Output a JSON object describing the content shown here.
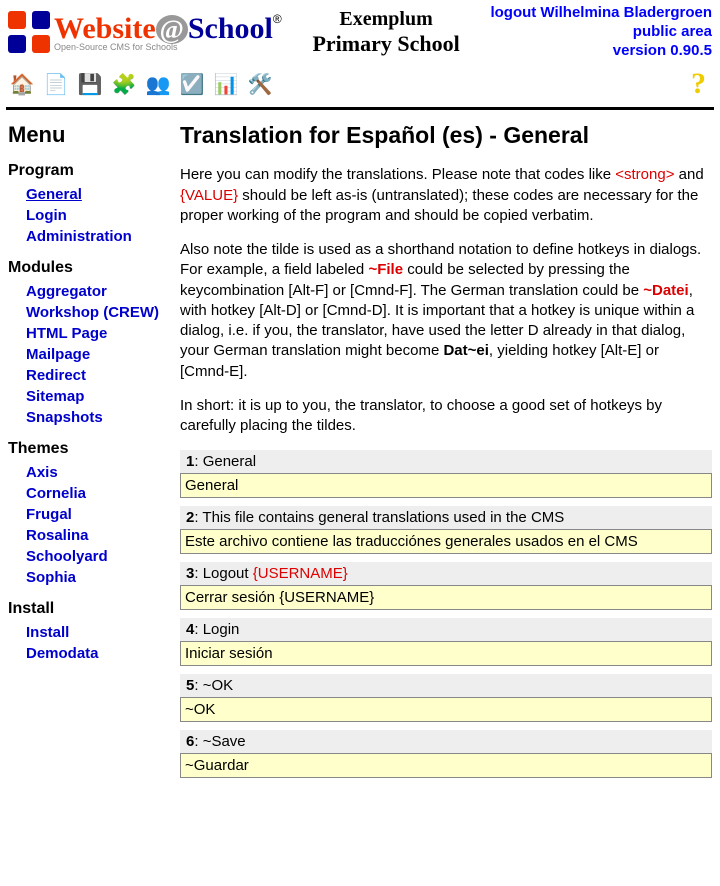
{
  "header": {
    "logo_main": "Website",
    "logo_at": "@",
    "logo_school": "School",
    "logo_tagline": "Open-Source CMS for Schools",
    "reg": "®",
    "school_line1": "Exemplum",
    "school_line2": "Primary School",
    "top_links": {
      "logout": "logout Wilhelmina Bladergroen",
      "public": "public area",
      "version": "version 0.90.5"
    }
  },
  "sidebar": {
    "title": "Menu",
    "groups": [
      {
        "label": "Program",
        "items": [
          "General",
          "Login",
          "Administration"
        ]
      },
      {
        "label": "Modules",
        "items": [
          "Aggregator",
          "Workshop (CREW)",
          "HTML Page",
          "Mailpage",
          "Redirect",
          "Sitemap",
          "Snapshots"
        ]
      },
      {
        "label": "Themes",
        "items": [
          "Axis",
          "Cornelia",
          "Frugal",
          "Rosalina",
          "Schoolyard",
          "Sophia"
        ]
      },
      {
        "label": "Install",
        "items": [
          "Install",
          "Demodata"
        ]
      }
    ]
  },
  "main": {
    "title": "Translation for Español (es) - General",
    "p1a": "Here you can modify the translations. Please note that codes like ",
    "p1c1": "<strong>",
    "p1b": " and ",
    "p1c2": "{VALUE}",
    "p1c": " should be left as-is (untranslated); these codes are necessary for the proper working of the program and should be copied verbatim.",
    "p2a": "Also note the tilde is used as a shorthand notation to define hotkeys in dialogs. For example, a field labeled ",
    "p2c1": "~File",
    "p2b": " could be selected by pressing the keycombination [Alt-F] or [Cmnd-F]. The German translation could be ",
    "p2c2": "~Datei",
    "p2c": ", with hotkey [Alt-D] or [Cmnd-D]. It is important that a hotkey is unique within a dialog, i.e. if you, the translator, have used the letter D already in that dialog, your German translation might become ",
    "p2c3": "Dat~ei",
    "p2d": ", yielding hotkey [Alt-E] or [Cmnd-E].",
    "p3": "In short: it is up to you, the translator, to choose a good set of hotkeys by carefully placing the tildes.",
    "entries": [
      {
        "idx": "1",
        "src": "General",
        "val": "General"
      },
      {
        "idx": "2",
        "src": "This file contains general translations used in the CMS",
        "val": "Este archivo contiene las traducciónes generales usados en el CMS"
      },
      {
        "idx": "3",
        "src_pre": "Logout ",
        "src_code": "{USERNAME}",
        "val": "Cerrar sesión {USERNAME}"
      },
      {
        "idx": "4",
        "src": "Login",
        "val": "Iniciar sesión"
      },
      {
        "idx": "5",
        "src": "~OK",
        "val": "~OK"
      },
      {
        "idx": "6",
        "src": "~Save",
        "val": "~Guardar"
      }
    ]
  }
}
